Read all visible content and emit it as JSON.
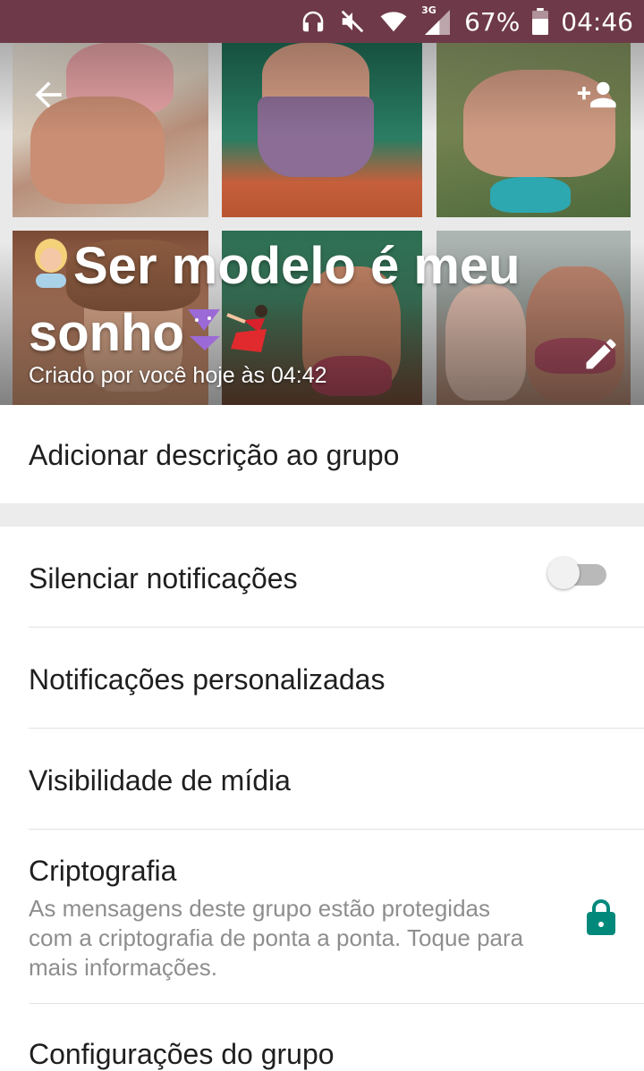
{
  "status_bar": {
    "battery": "67%",
    "time": "04:46",
    "network": "3G"
  },
  "header": {
    "title_part1": "Ser modelo é meu",
    "title_part2": "sonho",
    "created_by": "Criado por você hoje às 04:42"
  },
  "description": {
    "label": "Adicionar descrição ao grupo"
  },
  "settings": {
    "mute": {
      "label": "Silenciar notificações",
      "enabled": false
    },
    "custom_notifications": {
      "label": "Notificações personalizadas"
    },
    "media_visibility": {
      "label": "Visibilidade de mídia"
    },
    "encryption": {
      "label": "Criptografia",
      "description": "As mensagens deste grupo estão protegidas com a criptografia de ponta a ponta. Toque para mais informações."
    },
    "group_settings": {
      "label": "Configurações do grupo"
    }
  },
  "colors": {
    "status_bar": "#6e3948",
    "accent": "#00897b"
  },
  "icons": [
    "headphones-icon",
    "mute-icon",
    "wifi-icon",
    "signal-icon",
    "battery-icon",
    "back-arrow-icon",
    "add-participant-icon",
    "edit-pencil-icon",
    "lock-icon"
  ]
}
